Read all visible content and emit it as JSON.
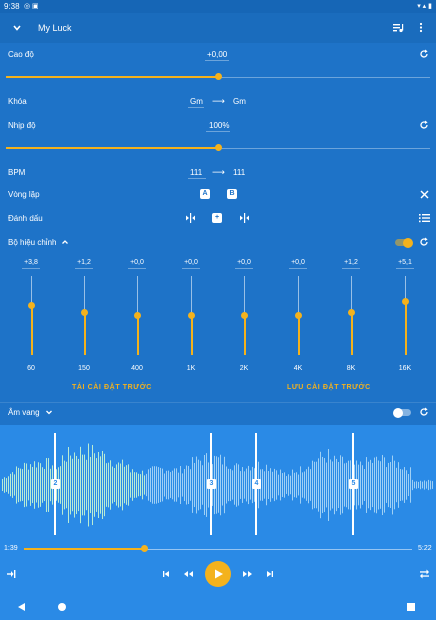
{
  "status": {
    "time": "9:38"
  },
  "appbar": {
    "title": "My Luck"
  },
  "pitch": {
    "label": "Cao độ",
    "value": "+0,00",
    "fraction": 0.5
  },
  "key": {
    "label": "Khóa",
    "from": "Gm",
    "arrow": "⟶",
    "to": "Gm"
  },
  "tempo": {
    "label": "Nhịp độ",
    "value": "100%",
    "fraction": 0.5
  },
  "bpm": {
    "label": "BPM",
    "from": "111",
    "arrow": "⟶",
    "to": "111"
  },
  "loop": {
    "label": "Vòng lặp",
    "a": "A",
    "b": "B"
  },
  "mark": {
    "label": "Đánh dấu",
    "add": "+"
  },
  "equalizer": {
    "label": "Bộ hiệu chỉnh",
    "enabled": true,
    "bands": [
      {
        "freq": "60",
        "gain": "+3,8",
        "level": 0.5
      },
      {
        "freq": "150",
        "gain": "+1,2",
        "level": 0.5
      },
      {
        "freq": "400",
        "gain": "+0,0",
        "level": 0.5
      },
      {
        "freq": "1K",
        "gain": "+0,0",
        "level": 0.5
      },
      {
        "freq": "2K",
        "gain": "+0,0",
        "level": 0.5
      },
      {
        "freq": "4K",
        "gain": "+0,0",
        "level": 0.5
      },
      {
        "freq": "8K",
        "gain": "+1,2",
        "level": 0.5
      },
      {
        "freq": "16K",
        "gain": "+5,1",
        "level": 0.5
      }
    ],
    "load_preset": "TẢI CÀI ĐẶT TRƯỚC",
    "save_preset": "LƯU CÀI ĐẶT TRƯỚC"
  },
  "reverb": {
    "label": "Âm vang",
    "enabled": false
  },
  "markers": [
    "2",
    "3",
    "4",
    "5"
  ],
  "player": {
    "elapsed": "1:39",
    "total": "5:22",
    "progress": 0.31
  },
  "colors": {
    "accent": "#f4b21d",
    "panel": "#1e73c8",
    "wave": "#2a8ae6",
    "waveform": "#9fd0f5",
    "waveform_played": "#b9ecd4"
  },
  "icons": [
    "chevron-down-icon",
    "queue-music-icon",
    "more-vert-icon",
    "reset-icon",
    "close-icon",
    "list-icon",
    "prev-mark-icon",
    "next-mark-icon",
    "exit-icon",
    "skip-start-icon",
    "rewind-icon",
    "play-icon",
    "fast-forward-icon",
    "skip-end-icon",
    "repeat-icon",
    "back-icon",
    "home-icon",
    "recents-icon"
  ]
}
